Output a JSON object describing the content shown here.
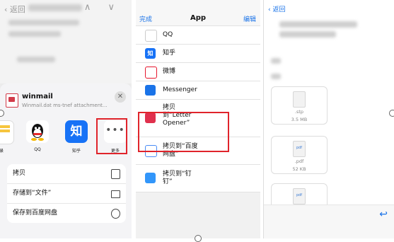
{
  "panel1": {
    "back_label": "返回",
    "nav_arrows": "∧ ∨",
    "attachment": {
      "title": "winmail",
      "subtitle": "Winmail.dat ms-tnef attachment..."
    },
    "close": "✕",
    "apps": [
      {
        "label": "录"
      },
      {
        "label": "QQ"
      },
      {
        "label": "知乎",
        "glyph": "知"
      },
      {
        "label": "更多",
        "glyph": "•••"
      }
    ],
    "actions": [
      {
        "label": "拷贝"
      },
      {
        "label": "存储到“文件”"
      },
      {
        "label": "保存到百度网盘"
      }
    ]
  },
  "panel2": {
    "done": "完成",
    "title": "App",
    "edit": "编辑",
    "items": [
      {
        "label": "QQ",
        "icon": "qq-icon"
      },
      {
        "label": "知乎",
        "icon": "zhihu-icon",
        "glyph": "知"
      },
      {
        "label": "微博",
        "icon": "weibo-icon"
      },
      {
        "label": "Messenger",
        "icon": "messenger-icon"
      },
      {
        "label": "拷贝\n到“Letter\nOpener”",
        "icon": "letter-opener-icon"
      },
      {
        "label": "拷贝到“百度\n网盘”",
        "icon": "baidu-netdisk-icon"
      },
      {
        "label": "拷贝到“钉\n钉”",
        "icon": "dingtalk-icon"
      }
    ]
  },
  "panel3": {
    "back_label": "返回",
    "files": [
      {
        "name": ".stp",
        "size": "3.5 MB",
        "type": ""
      },
      {
        "name": ".pdf",
        "size": "52 KB",
        "type": "pdf"
      },
      {
        "name": "",
        "size": "",
        "type": "pdf"
      }
    ]
  },
  "colors": {
    "accent": "#1a73e8",
    "highlight": "#e0242b",
    "zhihu": "#1772f6",
    "letter_opener": "#e0304d"
  }
}
